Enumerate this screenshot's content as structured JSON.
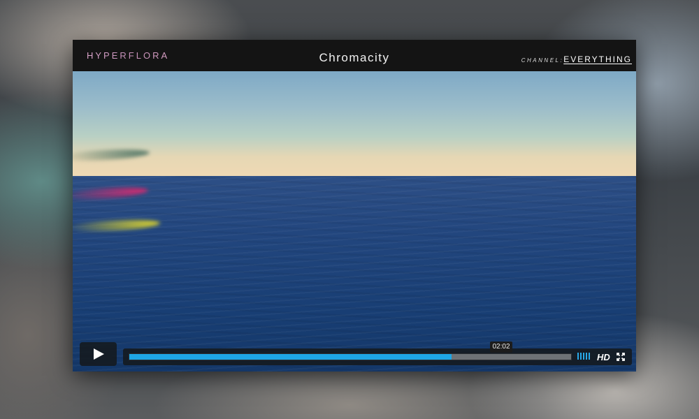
{
  "header": {
    "brand": "HYPERFLORA",
    "title": "Chromacity",
    "channel_label": "CHANNEL:",
    "channel_value": "EVERYTHING"
  },
  "player": {
    "time_tooltip": "02:02",
    "progress": 0.73,
    "quality_label": "HD",
    "volume_level": 1.0
  },
  "icons": {
    "play": "play-icon",
    "volume": "volume-icon",
    "fullscreen": "fullscreen-icon"
  },
  "colors": {
    "accent": "#1ea6e6",
    "brand": "#d9a0c4"
  }
}
